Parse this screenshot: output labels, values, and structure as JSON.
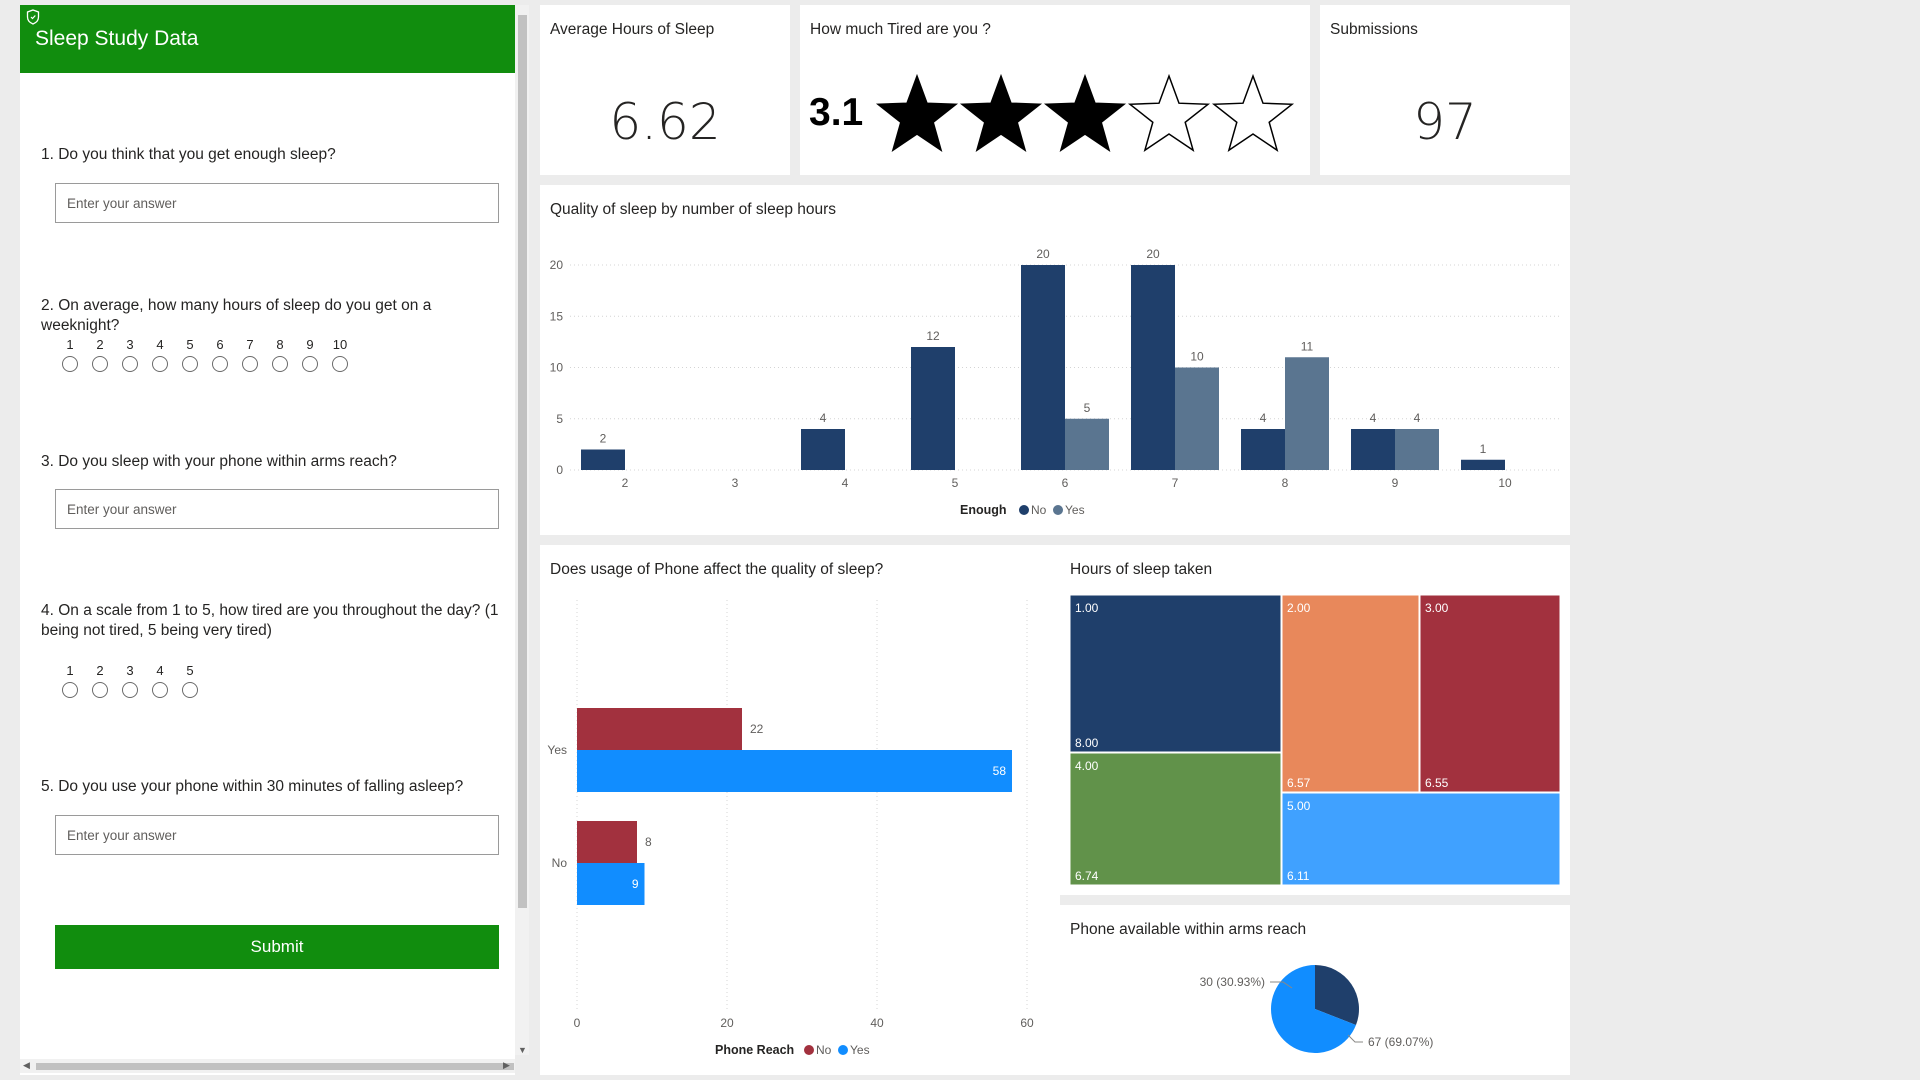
{
  "form": {
    "title": "Sleep Study Data",
    "questions": [
      {
        "text": "1. Do you think that you get enough sleep?",
        "placeholder": "Enter your answer"
      },
      {
        "text": "2. On average, how many hours of sleep do you get on a weeknight?",
        "options": [
          "1",
          "2",
          "3",
          "4",
          "5",
          "6",
          "7",
          "8",
          "9",
          "10"
        ]
      },
      {
        "text": "3. Do you sleep with your phone within arms reach?",
        "placeholder": "Enter your answer"
      },
      {
        "text": "4. On a scale from 1 to 5, how tired are you throughout the day? (1 being not tired, 5 being very tired)",
        "options": [
          "1",
          "2",
          "3",
          "4",
          "5"
        ]
      },
      {
        "text": "5.  Do you use your phone within 30 minutes of falling asleep?",
        "placeholder": "Enter your answer"
      }
    ],
    "submit_label": "Submit"
  },
  "kpis": {
    "avg_sleep": {
      "title": "Average Hours of Sleep",
      "value": "6.62"
    },
    "tired": {
      "title": "How much Tired are you ?",
      "value": "3.1",
      "stars_filled": 3,
      "stars_total": 5
    },
    "submissions": {
      "title": "Submissions",
      "value": "97"
    }
  },
  "colors": {
    "brand_green": "#118d0e",
    "series_no_dark": "#1f3f6b",
    "series_yes_slate": "#5a7590",
    "phone_no": "#a2313e",
    "phone_yes": "#118dff",
    "treemap": [
      "#1f3f6b",
      "#e8885b",
      "#a2313e",
      "#61924a",
      "#40a1ff"
    ]
  },
  "chart_data": [
    {
      "type": "bar",
      "title": "Quality of sleep by number of sleep hours",
      "categories": [
        "2",
        "3",
        "4",
        "5",
        "6",
        "7",
        "8",
        "9",
        "10"
      ],
      "series": [
        {
          "name": "No",
          "values": [
            2,
            null,
            4,
            12,
            20,
            20,
            4,
            4,
            1
          ]
        },
        {
          "name": "Yes",
          "values": [
            null,
            null,
            null,
            null,
            5,
            10,
            11,
            4,
            null
          ]
        }
      ],
      "yticks": [
        "0",
        "5",
        "10",
        "15",
        "20"
      ],
      "ylim": [
        0,
        20
      ],
      "legend_title": "Enough",
      "legend_position": "bottom-center",
      "grid": true
    },
    {
      "type": "bar",
      "orientation": "horizontal",
      "title": "Does usage of Phone affect the quality of sleep?",
      "categories": [
        "Yes",
        "No"
      ],
      "series": [
        {
          "name": "No",
          "values": [
            22,
            8
          ]
        },
        {
          "name": "Yes",
          "values": [
            58,
            9
          ]
        }
      ],
      "xticks": [
        "0",
        "20",
        "40",
        "60"
      ],
      "xlim": [
        0,
        60
      ],
      "legend_title": "Phone Reach",
      "legend_position": "bottom-center",
      "grid": true
    },
    {
      "type": "treemap",
      "title": "Hours of sleep taken",
      "items": [
        {
          "group": "1.00",
          "value": "8.00"
        },
        {
          "group": "2.00",
          "value": "6.57"
        },
        {
          "group": "3.00",
          "value": "6.55"
        },
        {
          "group": "4.00",
          "value": "6.74"
        },
        {
          "group": "5.00",
          "value": "6.11"
        }
      ]
    },
    {
      "type": "pie",
      "title": "Phone available within arms reach",
      "slices": [
        {
          "value": 30,
          "label": "30 (30.93%)"
        },
        {
          "value": 67,
          "label": "67 (69.07%)"
        }
      ]
    }
  ]
}
